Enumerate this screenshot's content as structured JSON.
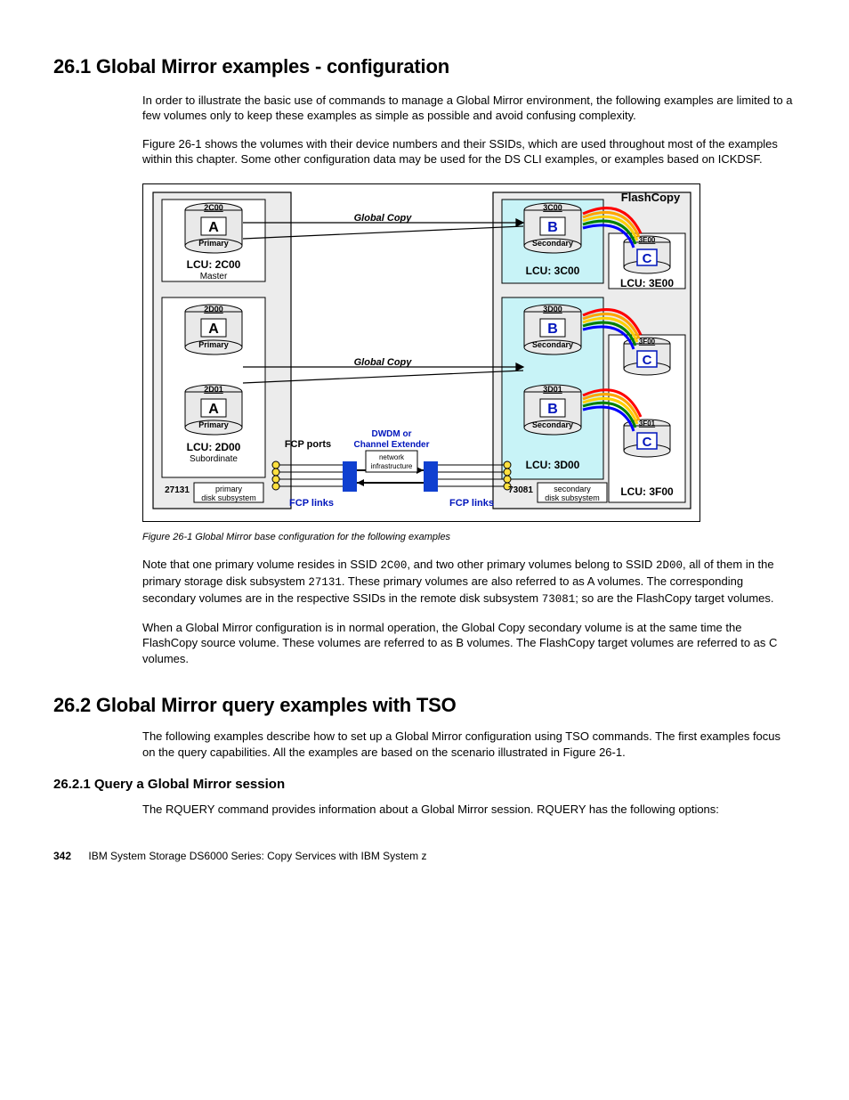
{
  "section1": {
    "heading": "26.1  Global Mirror examples - configuration",
    "p1": "In order to illustrate the basic use of commands to manage a Global Mirror environment, the following examples are limited to a few volumes only to keep these examples as simple as possible and avoid confusing complexity.",
    "p2": "Figure 26-1 shows the volumes with their device numbers and their SSIDs, which are used throughout most of the examples within this chapter. Some other configuration data may be used for the DS CLI examples, or examples based on ICKDSF.",
    "fig_caption": "Figure 26-1   Global Mirror base configuration for the following examples",
    "p3a": "Note that one primary volume resides in SSID ",
    "p3b": ", and two other primary volumes belong to SSID ",
    "p3c": ", all of them in the primary storage disk subsystem ",
    "p3d": ". These primary volumes are also referred to as A volumes. The corresponding secondary volumes are in the respective SSIDs in the remote disk subsystem ",
    "p3e": "; so are the FlashCopy target volumes.",
    "ssid1": "2C00",
    "ssid2": "2D00",
    "sub1": "27131",
    "sub2": "73081",
    "p4": "When a Global Mirror configuration is in normal operation, the Global Copy secondary volume is at the same time the FlashCopy source volume. These volumes are referred to as B volumes. The FlashCopy target volumes are referred to as C volumes."
  },
  "section2": {
    "heading": "26.2  Global Mirror query examples with TSO",
    "p1": "The following examples describe how to set up a Global Mirror configuration using TSO commands. The first examples focus on the query capabilities. All the examples are based on the scenario illustrated in Figure 26-1.",
    "sub_heading": "26.2.1  Query a Global Mirror session",
    "p2": "The RQUERY command provides information about a Global Mirror session. RQUERY has the following options:"
  },
  "footer": {
    "page": "342",
    "title": "IBM System Storage DS6000 Series: Copy Services with IBM System z"
  },
  "diagram": {
    "flashcopy_label": "FlashCopy",
    "global_copy_label": "Global Copy",
    "dwdm": "DWDM or",
    "chext": "Channel Extender",
    "fcp_ports": "FCP ports",
    "netinf1": "network",
    "netinf2": "infrastructure",
    "fcp_links": "FCP links",
    "primary_ds": "primary",
    "primary_ds2": "disk subsystem",
    "secondary_ds": "secondary",
    "secondary_ds2": "disk subsystem",
    "primary_id": "27131",
    "secondary_id": "73081",
    "A": "A",
    "B": "B",
    "C": "C",
    "primary": "Primary",
    "secondary": "Secondary",
    "master": "Master",
    "subordinate": "Subordinate",
    "lcu2c00": "LCU: 2C00",
    "lcu2d00": "LCU: 2D00",
    "lcu3c00": "LCU: 3C00",
    "lcu3d00": "LCU: 3D00",
    "lcu3e00": "LCU: 3E00",
    "lcu3f00": "LCU: 3F00",
    "d2c00": "2C00",
    "d2d00": "2D00",
    "d2d01": "2D01",
    "d3c00": "3C00",
    "d3d00": "3D00",
    "d3d01": "3D01",
    "d3e00": "3E00",
    "d3f00": "3F00",
    "d3f01": "3F01"
  }
}
